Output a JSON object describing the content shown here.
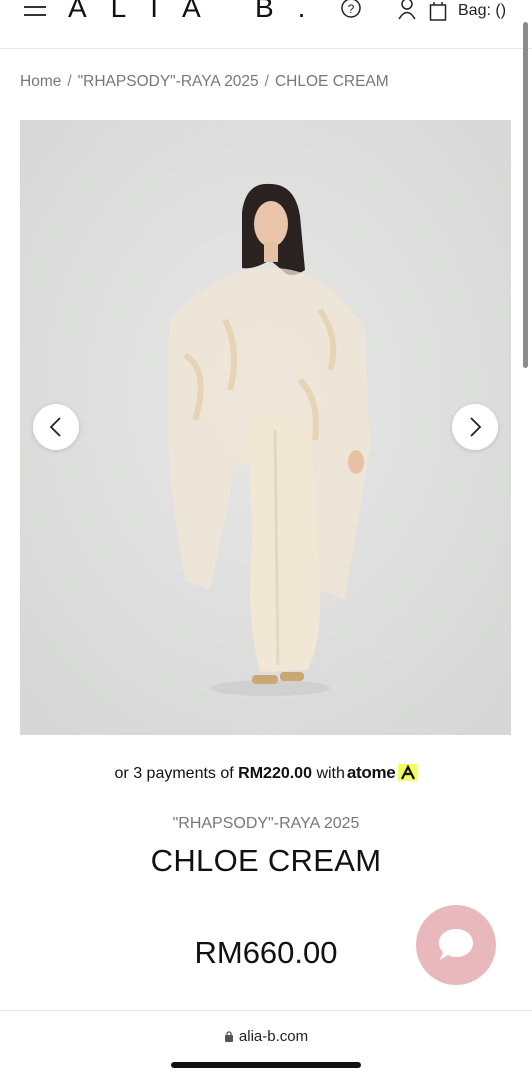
{
  "header": {
    "logo": "ALIA B.",
    "bag_label": "Bag: ()"
  },
  "breadcrumb": {
    "items": [
      "Home",
      "\"RHAPSODY\"-RAYA 2025",
      "CHLOE CREAM"
    ],
    "separator": "/"
  },
  "gallery": {
    "image_icon": "product-photo-model-in-cream-kaftan",
    "prev_icon": "chevron-left-icon",
    "next_icon": "chevron-right-icon"
  },
  "installment": {
    "prefix": "or 3 payments of",
    "amount": "RM220.00",
    "connector": "with",
    "provider": "atome"
  },
  "product": {
    "collection": "\"RHAPSODY\"-RAYA 2025",
    "title": "CHLOE CREAM",
    "price": "RM660.00"
  },
  "chat": {
    "icon": "chat-bubble-icon",
    "color": "#e9b8bc"
  },
  "browser": {
    "url": "alia-b.com"
  },
  "colors": {
    "text": "#111111",
    "muted": "#777777",
    "atome_accent": "#f0ff5f"
  }
}
